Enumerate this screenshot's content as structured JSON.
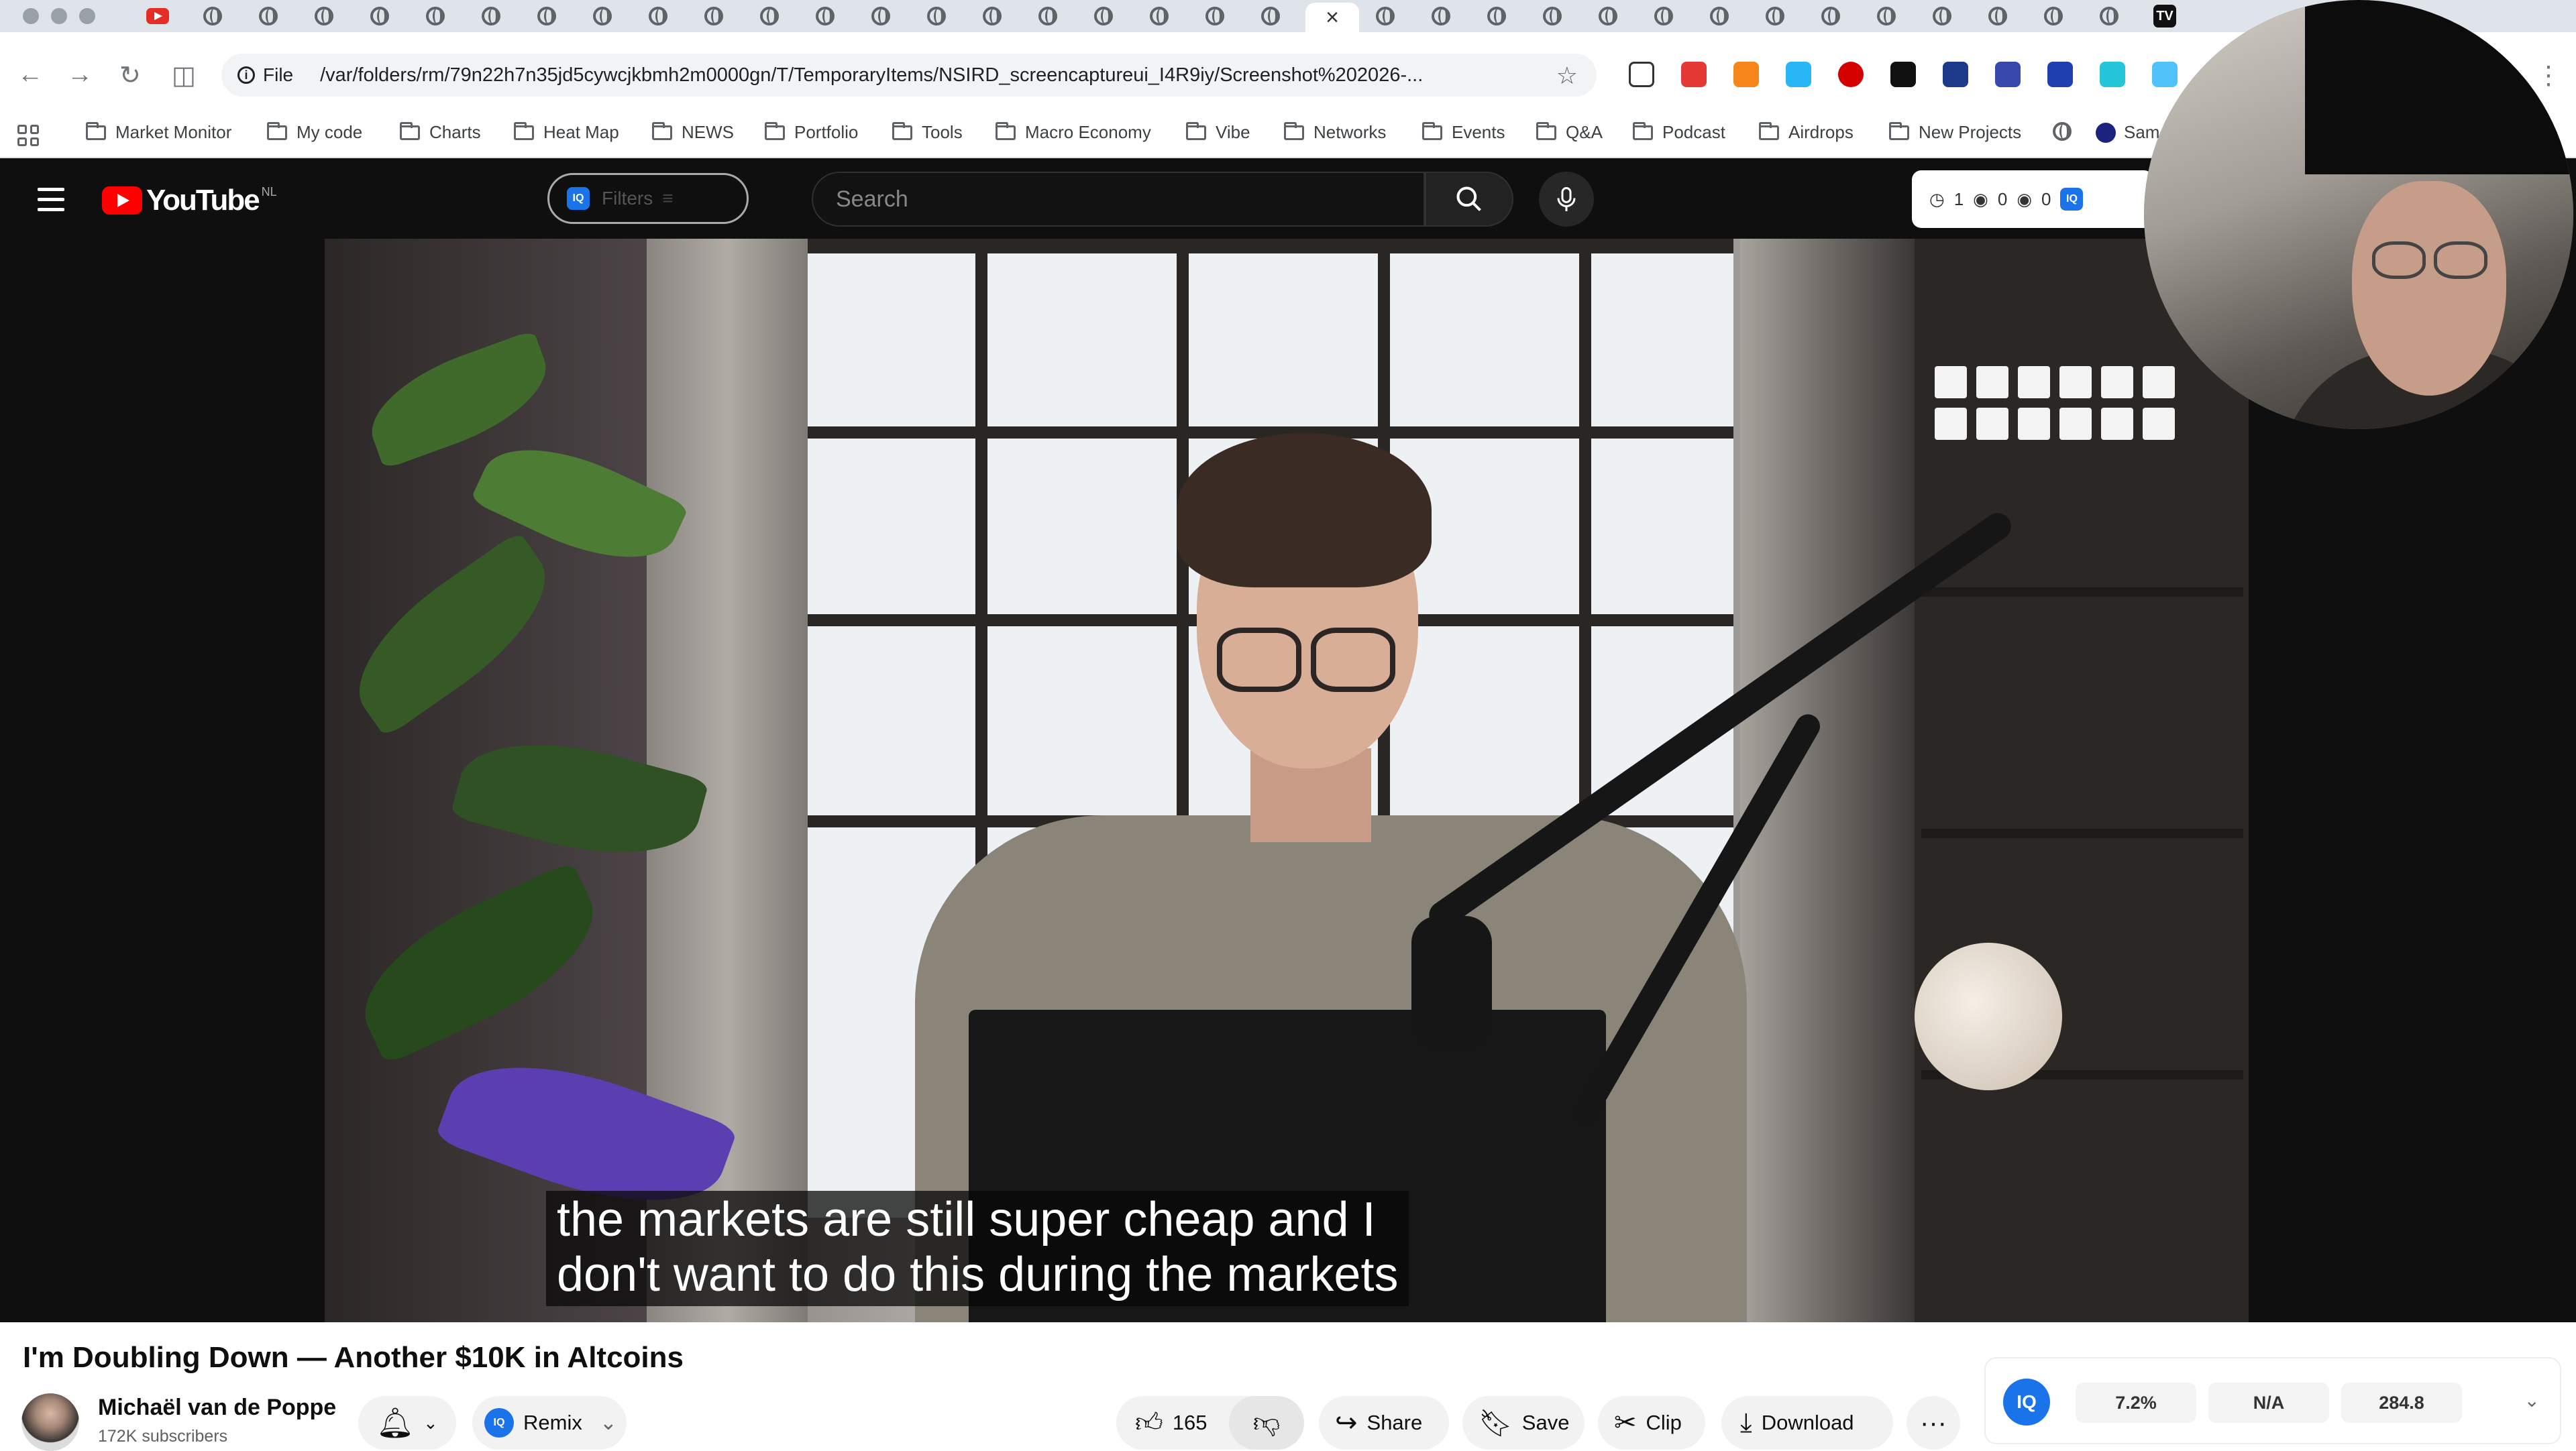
{
  "browser": {
    "url": "/var/folders/rm/79n22h7n35jd5cywcjkbmh2m0000gn/T/TemporaryItems/NSIRD_screencaptureui_I4R9iy/Screenshot%202026-...",
    "file_label": "File",
    "bookmarks": [
      "Market Monitor",
      "My code",
      "Charts",
      "Heat Map",
      "NEWS",
      "Portfolio",
      "Tools",
      "Macro Economy",
      "Vibe",
      "Networks",
      "Events",
      "Q&A",
      "Podcast",
      "Airdrops",
      "New Projects",
      "Sam"
    ]
  },
  "youtube": {
    "logo_text": "YouTube",
    "region": "NL",
    "filters_label": "Filters",
    "search_placeholder": "Search",
    "stats": {
      "history": "1",
      "views_a": "0",
      "views_b": "0"
    },
    "caption": "the markets are still super cheap and I\ndon't want to do this during the markets",
    "video_title": "I'm Doubling Down — Another $10K in Altcoins",
    "channel_name": "Michaël van de Poppe",
    "subscribers": "172K subscribers",
    "remix_label": "Remix",
    "like_count": "165",
    "share_label": "Share",
    "save_label": "Save",
    "clip_label": "Clip",
    "download_label": "Download",
    "iq": {
      "logo": "IQ",
      "v1": "7.2%",
      "v2": "N/A",
      "v3": "284.8"
    }
  }
}
